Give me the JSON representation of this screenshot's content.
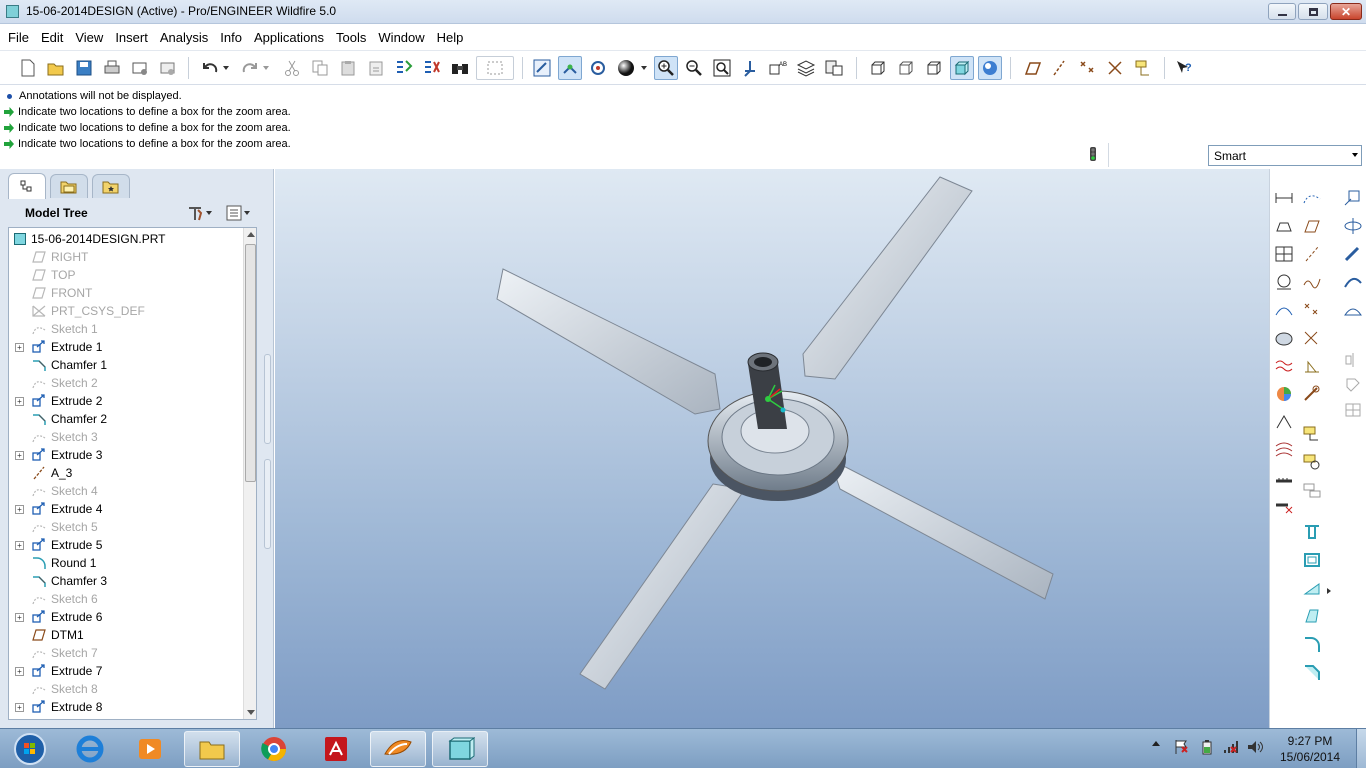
{
  "window": {
    "title": "15-06-2014DESIGN (Active) - Pro/ENGINEER Wildfire 5.0"
  },
  "menu": [
    "File",
    "Edit",
    "View",
    "Insert",
    "Analysis",
    "Info",
    "Applications",
    "Tools",
    "Window",
    "Help"
  ],
  "messages": [
    {
      "type": "info",
      "text": "Annotations will not be displayed."
    },
    {
      "type": "prompt",
      "text": "Indicate two locations to define a box for the zoom area."
    },
    {
      "type": "prompt",
      "text": "Indicate two locations to define a box for the zoom area."
    },
    {
      "type": "prompt",
      "text": "Indicate two locations to define a box for the zoom area."
    }
  ],
  "filter": {
    "value": "Smart"
  },
  "model_tree": {
    "title": "Model Tree",
    "root": "15-06-2014DESIGN.PRT",
    "items": [
      {
        "label": "RIGHT",
        "icon": "datum-plane-icon",
        "dim": true,
        "expand": false
      },
      {
        "label": "TOP",
        "icon": "datum-plane-icon",
        "dim": true,
        "expand": false
      },
      {
        "label": "FRONT",
        "icon": "datum-plane-icon",
        "dim": true,
        "expand": false
      },
      {
        "label": "PRT_CSYS_DEF",
        "icon": "csys-icon",
        "dim": true,
        "expand": false
      },
      {
        "label": "Sketch 1",
        "icon": "sketch-icon",
        "dim": true,
        "expand": false
      },
      {
        "label": "Extrude 1",
        "icon": "extrude-icon",
        "dim": false,
        "expand": true
      },
      {
        "label": "Chamfer 1",
        "icon": "chamfer-icon",
        "dim": false,
        "expand": false
      },
      {
        "label": "Sketch 2",
        "icon": "sketch-icon",
        "dim": true,
        "expand": false
      },
      {
        "label": "Extrude 2",
        "icon": "extrude-icon",
        "dim": false,
        "expand": true
      },
      {
        "label": "Chamfer 2",
        "icon": "chamfer-icon",
        "dim": false,
        "expand": false
      },
      {
        "label": "Sketch 3",
        "icon": "sketch-icon",
        "dim": true,
        "expand": false
      },
      {
        "label": "Extrude 3",
        "icon": "extrude-icon",
        "dim": false,
        "expand": true
      },
      {
        "label": "A_3",
        "icon": "axis-icon",
        "dim": false,
        "expand": false
      },
      {
        "label": "Sketch 4",
        "icon": "sketch-icon",
        "dim": true,
        "expand": false
      },
      {
        "label": "Extrude 4",
        "icon": "extrude-icon",
        "dim": false,
        "expand": true
      },
      {
        "label": "Sketch 5",
        "icon": "sketch-icon",
        "dim": true,
        "expand": false
      },
      {
        "label": "Extrude 5",
        "icon": "extrude-icon",
        "dim": false,
        "expand": true
      },
      {
        "label": "Round 1",
        "icon": "round-icon",
        "dim": false,
        "expand": false
      },
      {
        "label": "Chamfer 3",
        "icon": "chamfer-icon",
        "dim": false,
        "expand": false
      },
      {
        "label": "Sketch 6",
        "icon": "sketch-icon",
        "dim": true,
        "expand": false
      },
      {
        "label": "Extrude 6",
        "icon": "extrude-icon",
        "dim": false,
        "expand": true
      },
      {
        "label": "DTM1",
        "icon": "datum-plane-icon",
        "dim": false,
        "expand": false
      },
      {
        "label": "Sketch 7",
        "icon": "sketch-icon",
        "dim": true,
        "expand": false
      },
      {
        "label": "Extrude 7",
        "icon": "extrude-icon",
        "dim": false,
        "expand": true
      },
      {
        "label": "Sketch 8",
        "icon": "sketch-icon",
        "dim": true,
        "expand": false
      },
      {
        "label": "Extrude 8",
        "icon": "extrude-icon",
        "dim": false,
        "expand": true
      }
    ]
  },
  "taskbar": {
    "apps": [
      "start-orb-icon",
      "internet-explorer-icon",
      "media-player-icon",
      "file-explorer-icon",
      "chrome-icon",
      "adobe-reader-icon",
      "proe-icon",
      "cube-icon"
    ],
    "time": "9:27 PM",
    "date": "15/06/2014"
  }
}
